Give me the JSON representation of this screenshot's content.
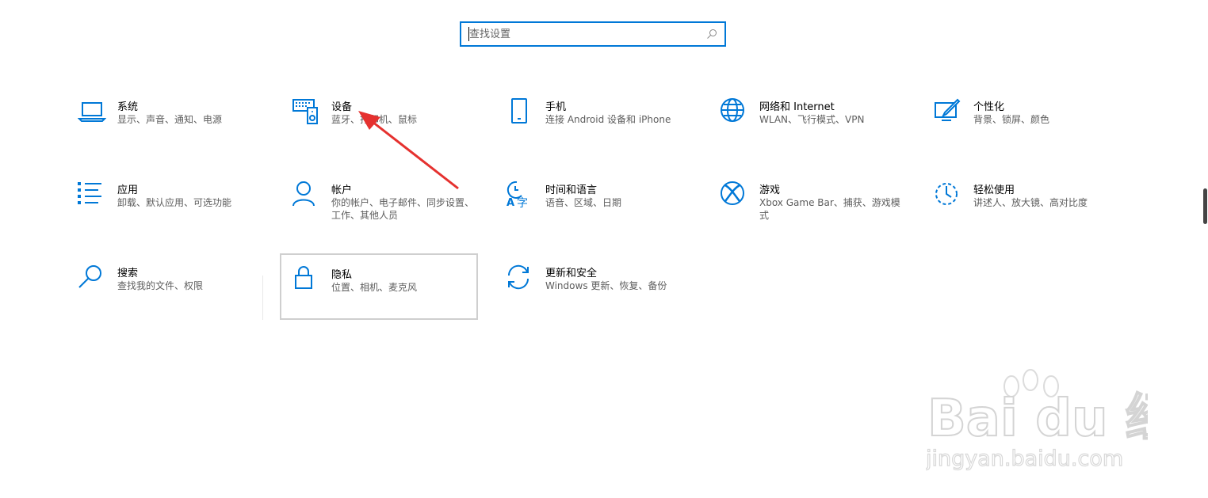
{
  "search": {
    "placeholder": "查找设置"
  },
  "tiles": [
    {
      "title": "系统",
      "desc": "显示、声音、通知、电源",
      "icon": "laptop-icon"
    },
    {
      "title": "设备",
      "desc": "蓝牙、打印机、鼠标",
      "icon": "keyboard-speaker-icon"
    },
    {
      "title": "手机",
      "desc": "连接 Android 设备和 iPhone",
      "icon": "phone-icon"
    },
    {
      "title": "网络和 Internet",
      "desc": "WLAN、飞行模式、VPN",
      "icon": "globe-icon"
    },
    {
      "title": "个性化",
      "desc": "背景、锁屏、颜色",
      "icon": "paint-icon"
    },
    {
      "title": "应用",
      "desc": "卸载、默认应用、可选功能",
      "icon": "apps-list-icon"
    },
    {
      "title": "帐户",
      "desc": "你的帐户、电子邮件、同步设置、工作、其他人员",
      "icon": "person-icon"
    },
    {
      "title": "时间和语言",
      "desc": "语音、区域、日期",
      "icon": "time-language-icon"
    },
    {
      "title": "游戏",
      "desc": "Xbox Game Bar、捕获、游戏模式",
      "icon": "xbox-icon"
    },
    {
      "title": "轻松使用",
      "desc": "讲述人、放大镜、高对比度",
      "icon": "ease-of-access-icon"
    },
    {
      "title": "搜索",
      "desc": "查找我的文件、权限",
      "icon": "search-icon"
    },
    {
      "title": "隐私",
      "desc": "位置、相机、麦克风",
      "icon": "lock-icon"
    },
    {
      "title": "更新和安全",
      "desc": "Windows 更新、恢复、备份",
      "icon": "sync-icon"
    }
  ],
  "watermark": {
    "brand": "Bai du 经验",
    "url": "jingyan.baidu.com"
  },
  "colors": {
    "accent": "#0078d7",
    "arrow": "#e5312f"
  }
}
